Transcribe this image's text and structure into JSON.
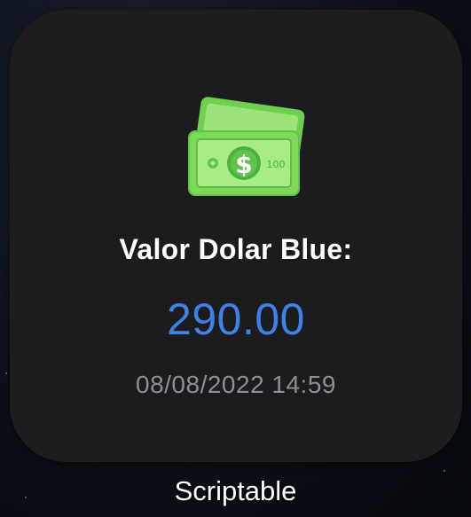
{
  "widget": {
    "icon": "money-banknotes-icon",
    "title": "Valor Dolar Blue:",
    "value": "290.00",
    "timestamp": "08/08/2022 14:59",
    "banknote_text": "100"
  },
  "app_label": "Scriptable",
  "colors": {
    "widget_background": "#1c1c1e",
    "title": "#ffffff",
    "value": "#3d82e6",
    "timestamp": "#8e8e93",
    "banknote_green": "#7ed957",
    "banknote_dark_green": "#4caf3f"
  }
}
